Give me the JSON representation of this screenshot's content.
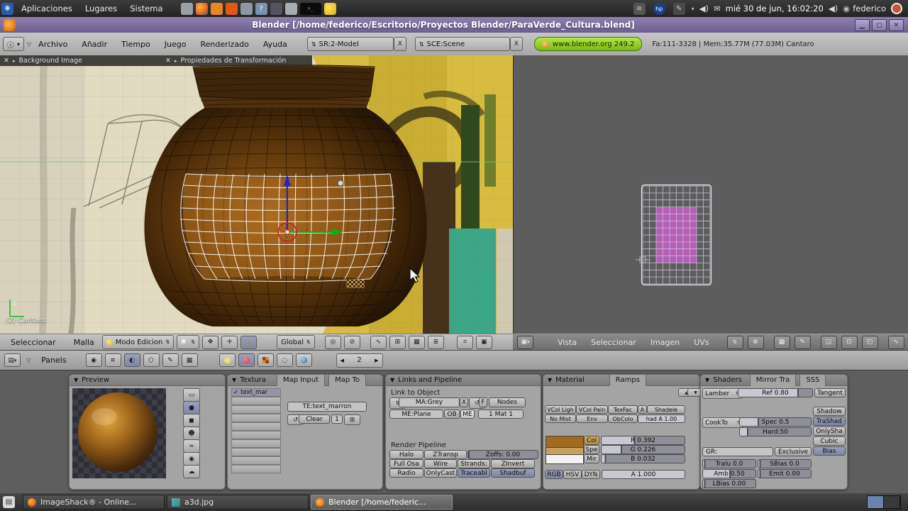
{
  "colors": {
    "titlebar_purple": "#7a6c9e",
    "version_green": "#8fd320",
    "uv_selection_magenta": "#c45ec4",
    "pot_brown": "#6e4210"
  },
  "gnome": {
    "menus": [
      "Aplicaciones",
      "Lugares",
      "Sistema"
    ],
    "clock": "mié 30 de jun, 16:02:20",
    "user": "federico"
  },
  "taskbar": {
    "windows": [
      "ImageShack® - Online...",
      "a3d.jpg",
      "Blender [/home/federic..."
    ]
  },
  "titlebar": {
    "title": "Blender [/home/federico/Escritorio/Proyectos Blender/ParaVerde_Cultura.blend]"
  },
  "topheader": {
    "menus": [
      "Archivo",
      "Añadir",
      "Tiempo",
      "Juego",
      "Renderizado",
      "Ayuda"
    ],
    "screen": "SR:2-Model",
    "scene": "SCE:Scene",
    "close": "X",
    "version": "www.blender.org 249.2",
    "stats": "Fa:111-3328 | Mem:35.77M (77.03M) Cantaro"
  },
  "view3d": {
    "panel1": "Background Image",
    "panel2": "Propiedades de Transformación",
    "object_info": "(2) Cantaro",
    "menu_select": "Seleccionar",
    "menu_mesh": "Malla",
    "mode": "Modo Edicion",
    "orientation": "Global"
  },
  "uveditor": {
    "menus": [
      "Vista",
      "Seleccionar",
      "Imagen",
      "UVs"
    ]
  },
  "buttonsheader": {
    "panels": "Panels",
    "frame": "2"
  },
  "preview": {
    "title": "Preview"
  },
  "texture": {
    "title": "Textura",
    "tab_map_input": "Map Input",
    "tab_map_to": "Map To",
    "channel": "text_mar",
    "name": "TE:text_marron",
    "clear": "Clear",
    "count": "1"
  },
  "links": {
    "title": "Links and Pipeline",
    "link_to_object": "Link to Object",
    "ma": "MA:Grey",
    "x": "X",
    "f": "F",
    "nodes": "Nodes",
    "me": "ME:Plane",
    "ob": "OB",
    "me_btn": "ME",
    "mat": "1 Mat 1",
    "render_pipeline": "Render Pipeline",
    "halo": "Halo",
    "ztransp": "ZTransp",
    "zoffs": "Zoffs: 0.00",
    "full_osa": "Full Osa",
    "wire": "Wire",
    "strands": "Strands:",
    "zinvert": "ZInvert",
    "radio": "Radio",
    "onlycast": "OnlyCast",
    "traceable": "Traceabl",
    "shadbuf": "Shadbuf"
  },
  "material": {
    "title": "Material",
    "tab_ramps": "Ramps",
    "vcol_light": "VCol Ligh",
    "vcol_paint": "VCol Pain",
    "texface": "TexFac",
    "a_btn": "A",
    "shadeless": "Shadele",
    "no_mist": "No Mist",
    "env": "Env",
    "obcolor": "ObColo",
    "shad_a": "had A 1.00",
    "col": "Col",
    "spe": "Spe",
    "mir": "Mir",
    "r": "R 0.392",
    "g": "G 0.226",
    "b": "B 0.032",
    "rgb": "RGB",
    "hsv": "HSV",
    "dyn": "DYN",
    "alpha": "A 1.000"
  },
  "shaders": {
    "title": "Shaders",
    "tab_mirror": "Mirror Tra",
    "tab_sss": "SSS",
    "diffuse": "Lamber",
    "ref": "Ref 0.80",
    "tangent": "Tangent",
    "shadow": "Shadow",
    "trashad": "TraShad",
    "onlysha": "OnlySha",
    "cubic": "Cubic",
    "bias": "Bias",
    "spec_model": "CookTo",
    "spec": "Spec 0.5",
    "hard": "Hard:50",
    "gr": "GR:",
    "exclusive": "Exclusive",
    "tralu": "Tralu 0.0",
    "sbias": "SBias 0.0",
    "amb": "Amb 0.50",
    "emit": "Emit 0.00",
    "lbias": "LBias 0.00"
  }
}
